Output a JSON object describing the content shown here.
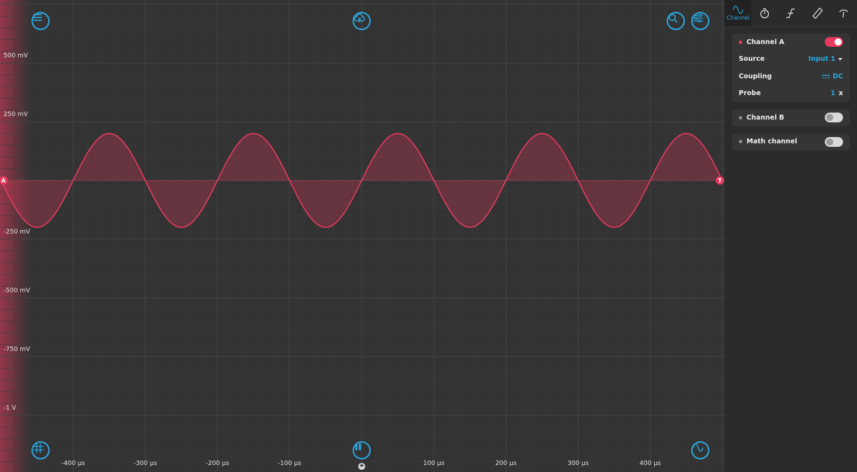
{
  "colors": {
    "background": "#333333",
    "grid": "#454545",
    "trace": "#e83a5e",
    "accent": "#2aa7e0",
    "sidebar": "#2b2b2b"
  },
  "toolbar": {
    "top_left_icon": "menu-icon",
    "top_center_icon": "cloud-upload-icon",
    "top_right_icons": [
      "search-icon",
      "sliders-icon"
    ],
    "bottom_left_icon": "grid-icon",
    "bottom_center_icon": "pause-icon",
    "bottom_right_icon": "waveform-icon"
  },
  "markers": {
    "channel": "A",
    "trigger": "T"
  },
  "chart_data": {
    "type": "line",
    "series": [
      {
        "name": "Channel A",
        "waveform": "sine",
        "amplitude_mV": 200,
        "offset_mV": 0,
        "period_us": 200,
        "phase_peak_us": -350
      }
    ],
    "xlim": [
      -500,
      500
    ],
    "ylim": [
      -1250,
      750
    ],
    "x_ticks": [
      -400,
      -300,
      -200,
      -100,
      100,
      200,
      300,
      400
    ],
    "x_tick_labels": [
      "-400 µs",
      "-300 µs",
      "-200 µs",
      "-100 µs",
      "100 µs",
      "200 µs",
      "300 µs",
      "400 µs"
    ],
    "y_ticks": [
      500,
      250,
      -250,
      -500,
      -750,
      -1000
    ],
    "y_tick_labels": [
      "500 mV",
      "250 mV",
      "-250 mV",
      "-500 mV",
      "-750 mV",
      "-1 V"
    ],
    "grid": true,
    "fill_under": true
  },
  "sidebar": {
    "tabs": [
      {
        "label": "Channel",
        "icon": "sine-wave-icon",
        "active": true
      },
      {
        "label": "",
        "icon": "stopwatch-icon",
        "active": false
      },
      {
        "label": "",
        "icon": "trigger-edge-icon",
        "active": false
      },
      {
        "label": "",
        "icon": "ruler-icon",
        "active": false
      },
      {
        "label": "",
        "icon": "probe-icon",
        "active": false
      }
    ],
    "channel_a": {
      "title": "Channel A",
      "enabled": true,
      "source_label": "Source",
      "source_value": "Input 1",
      "coupling_label": "Coupling",
      "coupling_value": "DC",
      "probe_label": "Probe",
      "probe_value": "1",
      "probe_unit": "x"
    },
    "channel_b": {
      "title": "Channel B",
      "enabled": false
    },
    "math_channel": {
      "title": "Math channel",
      "enabled": false
    }
  }
}
